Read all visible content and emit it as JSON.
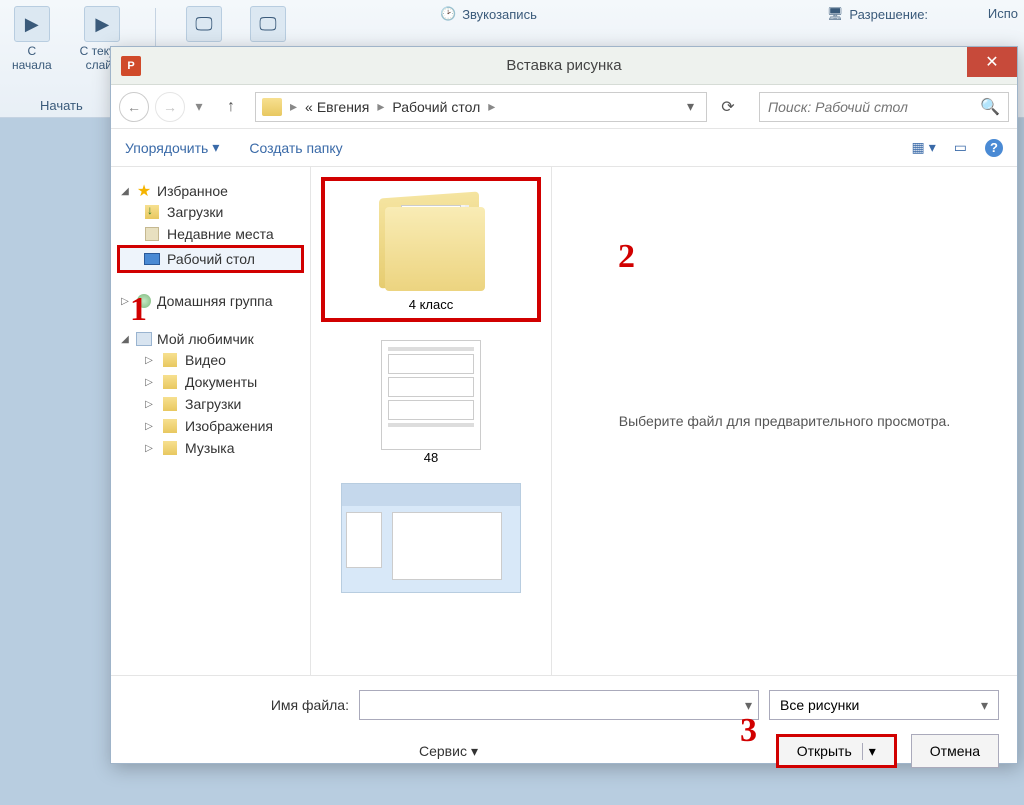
{
  "ribbon": {
    "from_start": "С\nначала",
    "from_current": "С текущ\nслайд",
    "start_section": "Начать",
    "sound_rec": "Звукозапись",
    "resolution": "Разрешение:",
    "use": "Испо"
  },
  "dialog": {
    "title": "Вставка рисунка",
    "close": "✕",
    "nav": {
      "bc_prefix": "«",
      "bc1": "Евгения",
      "bc2": "Рабочий стол",
      "search_placeholder": "Поиск: Рабочий стол"
    },
    "toolbar": {
      "organize": "Упорядочить",
      "new_folder": "Создать папку"
    },
    "sidebar": {
      "favorites": "Избранное",
      "downloads": "Загрузки",
      "recent": "Недавние места",
      "desktop": "Рабочий стол",
      "homegroup": "Домашняя группа",
      "computer": "Мой любимчик",
      "video": "Видео",
      "documents": "Документы",
      "downloads2": "Загрузки",
      "pictures": "Изображения",
      "music": "Музыка"
    },
    "files": {
      "folder1": "4 класс",
      "doc1": "48"
    },
    "preview": "Выберите файл для предварительного просмотра.",
    "footer": {
      "filename_label": "Имя файла:",
      "type_label": "Все рисунки",
      "tools": "Сервис",
      "open": "Открыть",
      "cancel": "Отмена"
    }
  },
  "annotations": {
    "a1": "1",
    "a2": "2",
    "a3": "3"
  }
}
